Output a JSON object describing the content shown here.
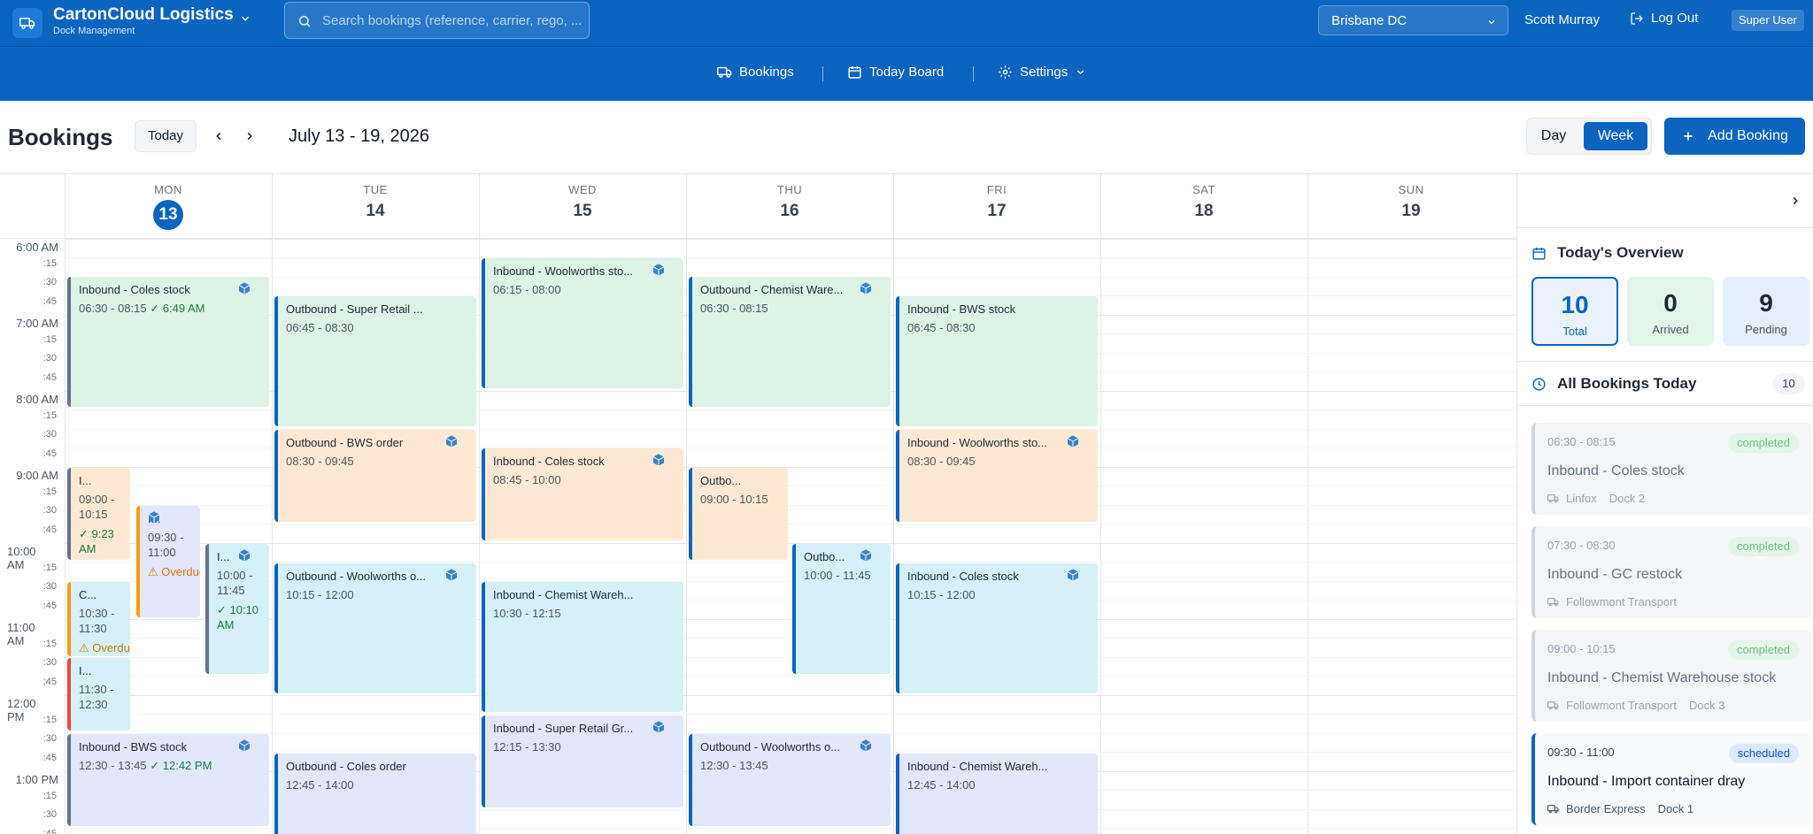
{
  "app": {
    "name": "CartonCloud Logistics",
    "subtitle": "Dock Management"
  },
  "search": {
    "placeholder": "Search bookings (reference, carrier, rego, ..."
  },
  "header": {
    "location": "Brisbane DC",
    "user": "Scott Murray",
    "logout": "Log Out",
    "role": "Super User"
  },
  "nav": {
    "bookings": "Bookings",
    "today_board": "Today Board",
    "settings": "Settings"
  },
  "toolbar": {
    "title": "Bookings",
    "today": "Today",
    "range": "July 13 - 19, 2026",
    "view_day": "Day",
    "view_week": "Week",
    "add_booking": "Add Booking"
  },
  "days": [
    {
      "dow": "MON",
      "num": "13"
    },
    {
      "dow": "TUE",
      "num": "14"
    },
    {
      "dow": "WED",
      "num": "15"
    },
    {
      "dow": "THU",
      "num": "16"
    },
    {
      "dow": "FRI",
      "num": "17"
    },
    {
      "dow": "SAT",
      "num": "18"
    },
    {
      "dow": "SUN",
      "num": "19"
    }
  ],
  "time_labels": {
    "h6": "6:00 AM",
    "h7": "7:00 AM",
    "h8": "8:00 AM",
    "h9": "9:00 AM",
    "h10": "10:00 AM",
    "h11": "11:00 AM",
    "h12": "12:00 PM",
    "h13": "1:00 PM",
    "q15": ":15",
    "q30": ":30",
    "q45": ":45"
  },
  "events": [
    {
      "title": "Inbound - Coles stock",
      "time": "06:30 - 08:15",
      "note": "✓ 6:49 AM"
    },
    {
      "title": "I...",
      "time": "09:00 - 10:15",
      "note": "✓ 9:23 AM"
    },
    {
      "title": "I...",
      "time": "09:30 - 11:00",
      "note": "⚠ Overdue"
    },
    {
      "title": "I...",
      "time": "10:00 - 11:45",
      "note": "✓ 10:10 AM"
    },
    {
      "title": "C...",
      "time": "10:30 - 11:30",
      "note": "⚠ Overdue"
    },
    {
      "title": "I...",
      "time": "11:30 - 12:30"
    },
    {
      "title": "Inbound - BWS stock",
      "time": "12:30 - 13:45",
      "note": "✓ 12:42 PM"
    },
    {
      "title": "Outbound - Super Retail ...",
      "time": "06:45 - 08:30"
    },
    {
      "title": "Outbound - BWS order",
      "time": "08:30 - 09:45"
    },
    {
      "title": "Outbound - Woolworths o...",
      "time": "10:15 - 12:00"
    },
    {
      "title": "Outbound - Coles order",
      "time": "12:45 - 14:00"
    },
    {
      "title": "Inbound - Woolworths sto...",
      "time": "06:15 - 08:00"
    },
    {
      "title": "Inbound - Coles stock",
      "time": "08:45 - 10:00"
    },
    {
      "title": "Inbound - Chemist Wareh...",
      "time": "10:30 - 12:15"
    },
    {
      "title": "Inbound - Super Retail Gr...",
      "time": "12:15 - 13:30"
    },
    {
      "title": "Outbound - Chemist Ware...",
      "time": "06:30 - 08:15"
    },
    {
      "title": "Outbo...",
      "time": "09:00 - 10:15"
    },
    {
      "title": "Outbo...",
      "time": "10:00 - 11:45"
    },
    {
      "title": "Outbound - Woolworths o...",
      "time": "12:30 - 13:45"
    },
    {
      "title": "Inbound - BWS stock",
      "time": "06:45 - 08:30"
    },
    {
      "title": "Inbound - Woolworths sto...",
      "time": "08:30 - 09:45"
    },
    {
      "title": "Inbound - Coles stock",
      "time": "10:15 - 12:00"
    },
    {
      "title": "Inbound - Chemist Wareh...",
      "time": "12:45 - 14:00"
    }
  ],
  "overview": {
    "title": "Today's Overview",
    "total": "10",
    "total_label": "Total",
    "arrived": "0",
    "arrived_label": "Arrived",
    "pending": "9",
    "pending_label": "Pending"
  },
  "today_list": {
    "title": "All Bookings Today",
    "count": "10",
    "items": [
      {
        "time": "06:30 - 08:15",
        "name": "Inbound - Coles stock",
        "carrier": "Linfox",
        "dock": "Dock 2",
        "status": "completed"
      },
      {
        "time": "07:30 - 08:30",
        "name": "Inbound - GC restock",
        "carrier": "Followmont Transport",
        "dock": "",
        "status": "completed"
      },
      {
        "time": "09:00 - 10:15",
        "name": "Inbound - Chemist Warehouse stock",
        "carrier": "Followmont Transport",
        "dock": "Dock 3",
        "status": "completed"
      },
      {
        "time": "09:30 - 11:00",
        "name": "Inbound - Import container dray",
        "carrier": "Border Express",
        "dock": "Dock 1",
        "status": "scheduled"
      }
    ]
  },
  "colors": {
    "primary": "#0a64c0",
    "green": "#dcf3e6",
    "orange": "#fde9d3",
    "cyan": "#d5f1f7",
    "lavender": "#e2e7fa",
    "overdue": "#d97706",
    "arrived": "#15803d"
  }
}
